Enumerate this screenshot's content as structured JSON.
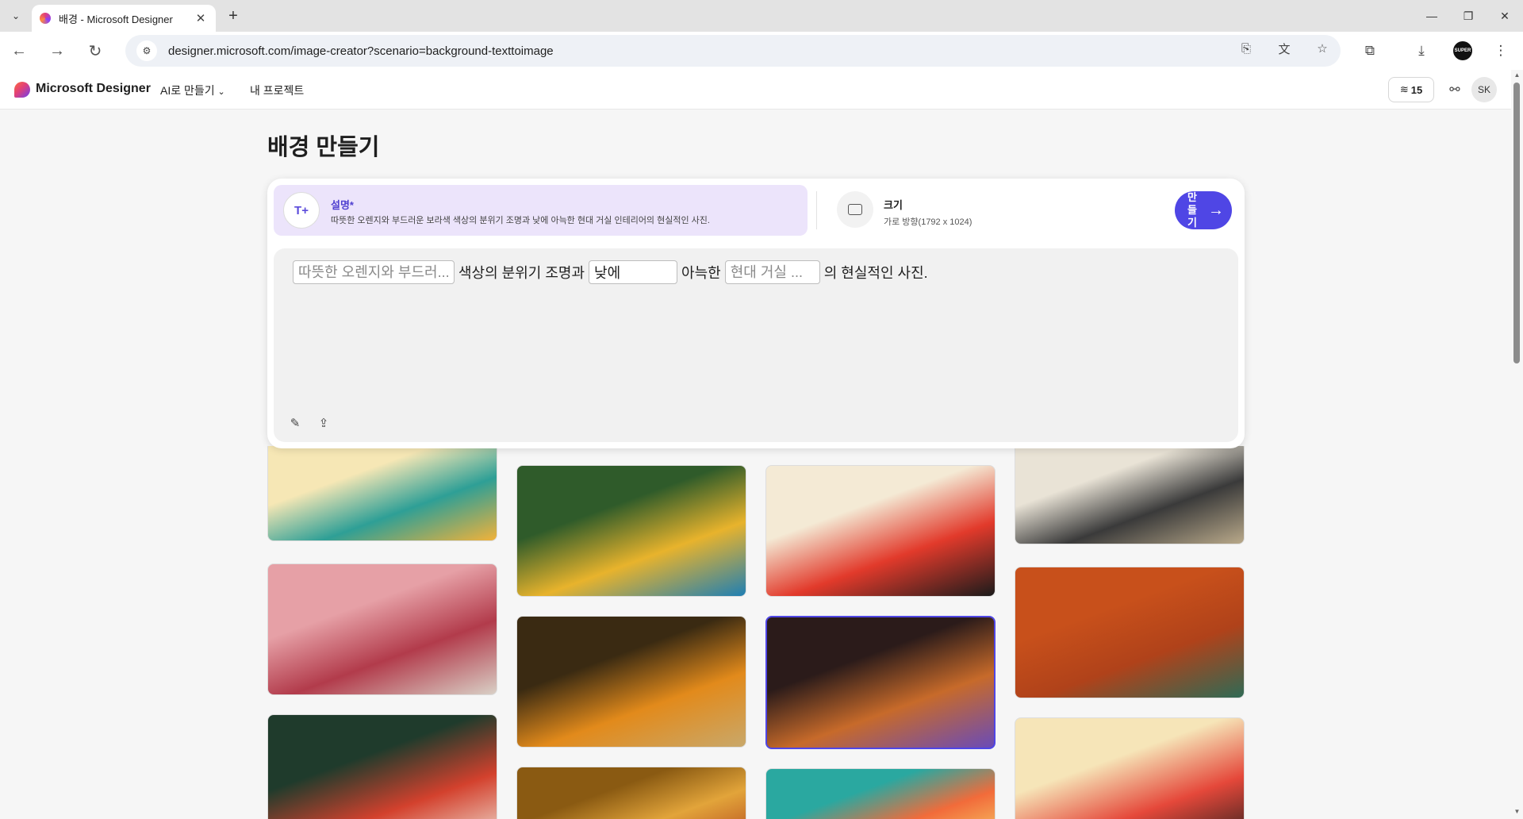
{
  "browser": {
    "tab_title": "배경 - Microsoft Designer",
    "url": "designer.microsoft.com/image-creator?scenario=background-texttoimage",
    "profile_badge": "SUPER"
  },
  "app": {
    "brand": "Microsoft Designer",
    "nav": {
      "ai_create": "AI로 만들기",
      "my_projects": "내 프로젝트"
    },
    "credits": "15",
    "avatar": "SK"
  },
  "page": {
    "title": "배경 만들기"
  },
  "description": {
    "label": "설명*",
    "text": "따뜻한 오렌지와 부드러운 보라색 색상의 분위기 조명과 낮에 아늑한 현대 거실 인테리어의 현실적인 사진."
  },
  "size": {
    "label": "크기",
    "value": "가로 방향(1792 x 1024)"
  },
  "create_button": {
    "label": "만들기"
  },
  "prompt": {
    "field1_placeholder": "따뜻한 오렌지와 부드러...",
    "text1": "색상의 분위기 조명과",
    "field2_value": "낮에",
    "text2": "아늑한",
    "field3_placeholder": "현대 거실 ...",
    "text3": "의 현실적인 사진."
  },
  "gallery": {
    "items": [
      {
        "name": "cyclists-landscape",
        "colors": [
          "#f6e7b5",
          "#2e9f96",
          "#f2b23a"
        ]
      },
      {
        "name": "autumn-park-lake",
        "colors": [
          "#2f5b2a",
          "#e8b32c",
          "#1f7fb3"
        ]
      },
      {
        "name": "red-trees-cyclists",
        "colors": [
          "#f4ead5",
          "#e23a2b",
          "#1b1b1b"
        ]
      },
      {
        "name": "cubist-vase",
        "colors": [
          "#e9e3d6",
          "#3a3a3a",
          "#b9a98a"
        ]
      },
      {
        "name": "pink-futuristic-city",
        "colors": [
          "#e6a0a6",
          "#b23b4b",
          "#d9d0c6"
        ]
      },
      {
        "name": "autumn-forest-path",
        "colors": [
          "#3a2a12",
          "#e28a1b",
          "#c9a86a"
        ]
      },
      {
        "name": "cozy-living-room",
        "colors": [
          "#2b1b1a",
          "#c76a2a",
          "#6a4bb8"
        ]
      },
      {
        "name": "skyscraper-orange",
        "colors": [
          "#c8501b",
          "#b0421a",
          "#2f6a55"
        ]
      },
      {
        "name": "flowers-bouquet",
        "colors": [
          "#1f3b2c",
          "#d3412d",
          "#f1e9dd"
        ]
      },
      {
        "name": "golden-flowers",
        "colors": [
          "#8a5a12",
          "#e2a43a",
          "#b54a1e"
        ]
      },
      {
        "name": "retro-building-rays",
        "colors": [
          "#2aa8a0",
          "#f26b3a",
          "#f6d36b"
        ]
      },
      {
        "name": "sunset-tower",
        "colors": [
          "#f6e5b8",
          "#e5483a",
          "#1b1b1b"
        ]
      }
    ]
  }
}
